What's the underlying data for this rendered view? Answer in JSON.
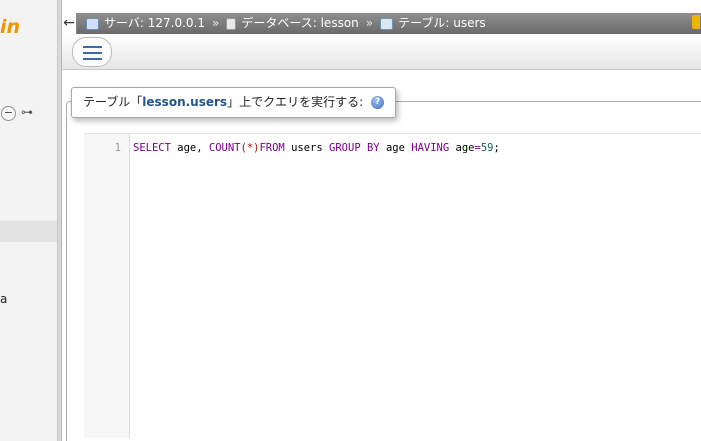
{
  "nav": {
    "logo_fragment": "in",
    "collapse_symbol": "−",
    "link_symbol": "⊶",
    "partial_letter": "a"
  },
  "breadcrumb": {
    "back_symbol": "←",
    "server_label": "サーバ: 127.0.0.1",
    "database_label": "データベース: lesson",
    "table_label": "テーブル: users",
    "separator": "»"
  },
  "query_panel": {
    "legend_prefix": "テーブル「",
    "legend_db": "lesson.users",
    "legend_suffix": "」上でクエリを実行する:",
    "help_symbol": "?"
  },
  "editor": {
    "line_number": "1",
    "tokens": {
      "select": "SELECT",
      "age1": "age,",
      "count": "COUNT",
      "paren_star": "(*)",
      "from": "FROM",
      "users": "users",
      "group": "GROUP",
      "by": "BY",
      "age2": "age",
      "having": "HAVING",
      "age3": "age",
      "eq": "=",
      "value": "59",
      "semicolon": ";"
    }
  },
  "colors": {
    "keyword": "#770088",
    "number": "#116644",
    "operator": "#aa1111",
    "logo": "#f29400",
    "legend_db": "#23558a"
  }
}
